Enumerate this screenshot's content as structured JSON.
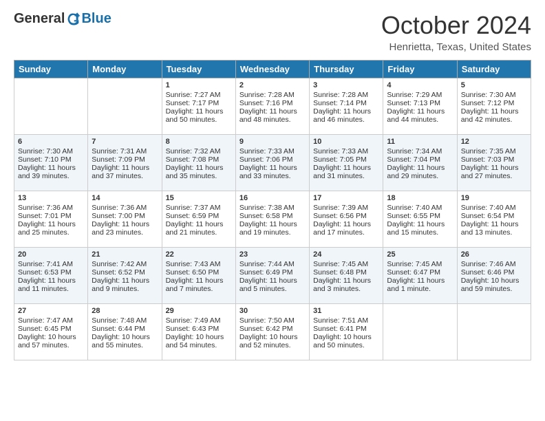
{
  "header": {
    "logo_general": "General",
    "logo_blue": "Blue",
    "month_title": "October 2024",
    "location": "Henrietta, Texas, United States"
  },
  "days_of_week": [
    "Sunday",
    "Monday",
    "Tuesday",
    "Wednesday",
    "Thursday",
    "Friday",
    "Saturday"
  ],
  "weeks": [
    [
      {
        "day": "",
        "sunrise": "",
        "sunset": "",
        "daylight": ""
      },
      {
        "day": "",
        "sunrise": "",
        "sunset": "",
        "daylight": ""
      },
      {
        "day": "1",
        "sunrise": "Sunrise: 7:27 AM",
        "sunset": "Sunset: 7:17 PM",
        "daylight": "Daylight: 11 hours and 50 minutes."
      },
      {
        "day": "2",
        "sunrise": "Sunrise: 7:28 AM",
        "sunset": "Sunset: 7:16 PM",
        "daylight": "Daylight: 11 hours and 48 minutes."
      },
      {
        "day": "3",
        "sunrise": "Sunrise: 7:28 AM",
        "sunset": "Sunset: 7:14 PM",
        "daylight": "Daylight: 11 hours and 46 minutes."
      },
      {
        "day": "4",
        "sunrise": "Sunrise: 7:29 AM",
        "sunset": "Sunset: 7:13 PM",
        "daylight": "Daylight: 11 hours and 44 minutes."
      },
      {
        "day": "5",
        "sunrise": "Sunrise: 7:30 AM",
        "sunset": "Sunset: 7:12 PM",
        "daylight": "Daylight: 11 hours and 42 minutes."
      }
    ],
    [
      {
        "day": "6",
        "sunrise": "Sunrise: 7:30 AM",
        "sunset": "Sunset: 7:10 PM",
        "daylight": "Daylight: 11 hours and 39 minutes."
      },
      {
        "day": "7",
        "sunrise": "Sunrise: 7:31 AM",
        "sunset": "Sunset: 7:09 PM",
        "daylight": "Daylight: 11 hours and 37 minutes."
      },
      {
        "day": "8",
        "sunrise": "Sunrise: 7:32 AM",
        "sunset": "Sunset: 7:08 PM",
        "daylight": "Daylight: 11 hours and 35 minutes."
      },
      {
        "day": "9",
        "sunrise": "Sunrise: 7:33 AM",
        "sunset": "Sunset: 7:06 PM",
        "daylight": "Daylight: 11 hours and 33 minutes."
      },
      {
        "day": "10",
        "sunrise": "Sunrise: 7:33 AM",
        "sunset": "Sunset: 7:05 PM",
        "daylight": "Daylight: 11 hours and 31 minutes."
      },
      {
        "day": "11",
        "sunrise": "Sunrise: 7:34 AM",
        "sunset": "Sunset: 7:04 PM",
        "daylight": "Daylight: 11 hours and 29 minutes."
      },
      {
        "day": "12",
        "sunrise": "Sunrise: 7:35 AM",
        "sunset": "Sunset: 7:03 PM",
        "daylight": "Daylight: 11 hours and 27 minutes."
      }
    ],
    [
      {
        "day": "13",
        "sunrise": "Sunrise: 7:36 AM",
        "sunset": "Sunset: 7:01 PM",
        "daylight": "Daylight: 11 hours and 25 minutes."
      },
      {
        "day": "14",
        "sunrise": "Sunrise: 7:36 AM",
        "sunset": "Sunset: 7:00 PM",
        "daylight": "Daylight: 11 hours and 23 minutes."
      },
      {
        "day": "15",
        "sunrise": "Sunrise: 7:37 AM",
        "sunset": "Sunset: 6:59 PM",
        "daylight": "Daylight: 11 hours and 21 minutes."
      },
      {
        "day": "16",
        "sunrise": "Sunrise: 7:38 AM",
        "sunset": "Sunset: 6:58 PM",
        "daylight": "Daylight: 11 hours and 19 minutes."
      },
      {
        "day": "17",
        "sunrise": "Sunrise: 7:39 AM",
        "sunset": "Sunset: 6:56 PM",
        "daylight": "Daylight: 11 hours and 17 minutes."
      },
      {
        "day": "18",
        "sunrise": "Sunrise: 7:40 AM",
        "sunset": "Sunset: 6:55 PM",
        "daylight": "Daylight: 11 hours and 15 minutes."
      },
      {
        "day": "19",
        "sunrise": "Sunrise: 7:40 AM",
        "sunset": "Sunset: 6:54 PM",
        "daylight": "Daylight: 11 hours and 13 minutes."
      }
    ],
    [
      {
        "day": "20",
        "sunrise": "Sunrise: 7:41 AM",
        "sunset": "Sunset: 6:53 PM",
        "daylight": "Daylight: 11 hours and 11 minutes."
      },
      {
        "day": "21",
        "sunrise": "Sunrise: 7:42 AM",
        "sunset": "Sunset: 6:52 PM",
        "daylight": "Daylight: 11 hours and 9 minutes."
      },
      {
        "day": "22",
        "sunrise": "Sunrise: 7:43 AM",
        "sunset": "Sunset: 6:50 PM",
        "daylight": "Daylight: 11 hours and 7 minutes."
      },
      {
        "day": "23",
        "sunrise": "Sunrise: 7:44 AM",
        "sunset": "Sunset: 6:49 PM",
        "daylight": "Daylight: 11 hours and 5 minutes."
      },
      {
        "day": "24",
        "sunrise": "Sunrise: 7:45 AM",
        "sunset": "Sunset: 6:48 PM",
        "daylight": "Daylight: 11 hours and 3 minutes."
      },
      {
        "day": "25",
        "sunrise": "Sunrise: 7:45 AM",
        "sunset": "Sunset: 6:47 PM",
        "daylight": "Daylight: 11 hours and 1 minute."
      },
      {
        "day": "26",
        "sunrise": "Sunrise: 7:46 AM",
        "sunset": "Sunset: 6:46 PM",
        "daylight": "Daylight: 10 hours and 59 minutes."
      }
    ],
    [
      {
        "day": "27",
        "sunrise": "Sunrise: 7:47 AM",
        "sunset": "Sunset: 6:45 PM",
        "daylight": "Daylight: 10 hours and 57 minutes."
      },
      {
        "day": "28",
        "sunrise": "Sunrise: 7:48 AM",
        "sunset": "Sunset: 6:44 PM",
        "daylight": "Daylight: 10 hours and 55 minutes."
      },
      {
        "day": "29",
        "sunrise": "Sunrise: 7:49 AM",
        "sunset": "Sunset: 6:43 PM",
        "daylight": "Daylight: 10 hours and 54 minutes."
      },
      {
        "day": "30",
        "sunrise": "Sunrise: 7:50 AM",
        "sunset": "Sunset: 6:42 PM",
        "daylight": "Daylight: 10 hours and 52 minutes."
      },
      {
        "day": "31",
        "sunrise": "Sunrise: 7:51 AM",
        "sunset": "Sunset: 6:41 PM",
        "daylight": "Daylight: 10 hours and 50 minutes."
      },
      {
        "day": "",
        "sunrise": "",
        "sunset": "",
        "daylight": ""
      },
      {
        "day": "",
        "sunrise": "",
        "sunset": "",
        "daylight": ""
      }
    ]
  ]
}
